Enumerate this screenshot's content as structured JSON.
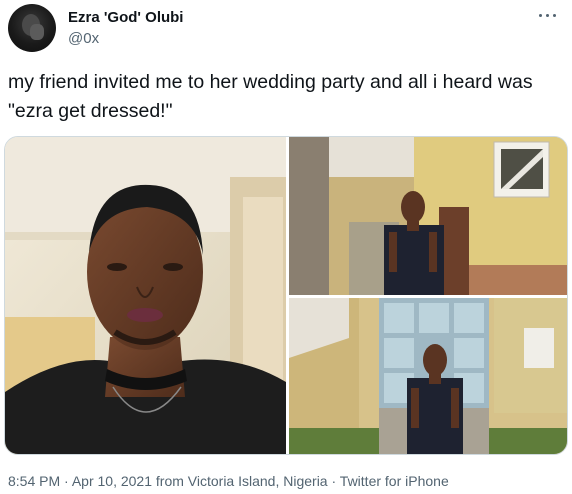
{
  "tweet": {
    "author": {
      "display_name": "Ezra 'God' Olubi",
      "handle": "@0x"
    },
    "text": "my friend invited me to her wedding party and all i heard was \"ezra get dressed!\"",
    "media": [
      {
        "alt": "selfie of man in black top with choker necklace"
      },
      {
        "alt": "man in black outfit standing outside yellow building"
      },
      {
        "alt": "man in black outfit standing in front of glass door"
      }
    ],
    "meta": {
      "time": "8:54 PM",
      "date": "Apr 10, 2021",
      "location": "from Victoria Island, Nigeria",
      "source": "Twitter for iPhone",
      "separator": "·"
    }
  },
  "colors": {
    "text_primary": "#0f1419",
    "text_secondary": "#536471",
    "border": "#cfd9de"
  },
  "icons": {
    "more": "more-horizontal-icon"
  }
}
